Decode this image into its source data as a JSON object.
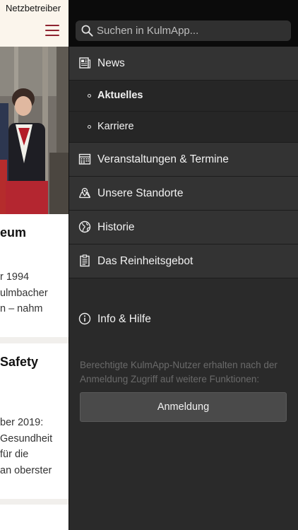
{
  "status_bar": {
    "carrier": "Netzbetreiber"
  },
  "background_page": {
    "menu_icon": "hamburger-icon",
    "card1": {
      "title": "eum",
      "lines": [
        "r 1994",
        "ulmbacher",
        "n – nahm"
      ]
    },
    "card2": {
      "title": "Safety",
      "lines": [
        "ber 2019:",
        "Gesundheit",
        " für die",
        "an oberster"
      ]
    }
  },
  "drawer": {
    "search": {
      "placeholder": "Suchen in KulmApp...",
      "value": ""
    },
    "menu": [
      {
        "label": "News",
        "icon": "newspaper-icon"
      },
      {
        "label": "Aktuelles",
        "sub": true,
        "active": true
      },
      {
        "label": "Karriere",
        "sub": true,
        "active": false
      },
      {
        "label": "Veranstaltungen & Termine",
        "icon": "calendar-icon"
      },
      {
        "label": "Unsere Standorte",
        "icon": "map-pin-icon"
      },
      {
        "label": "Historie",
        "icon": "globe-icon"
      },
      {
        "label": "Das Reinheitsgebot",
        "icon": "clipboard-icon"
      }
    ],
    "info": {
      "label": "Info & Hilfe",
      "icon": "info-icon"
    },
    "login_note": "Berechtigte KulmApp-Nutzer erhalten nach der Anmeldung Zugriff auf weitere Funktionen:",
    "login_button": "Anmeldung"
  },
  "colors": {
    "brand": "#8e2330",
    "drawer_bg": "#2a2a2a",
    "item_bg": "#333333",
    "subitem_bg": "#262626"
  }
}
